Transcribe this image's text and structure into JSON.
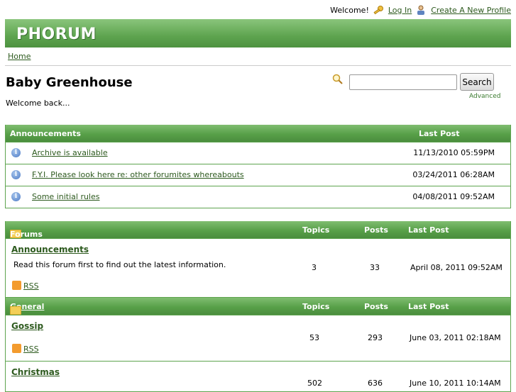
{
  "topbar": {
    "welcome": "Welcome!",
    "login": "Log In",
    "create_profile": "Create A New Profile"
  },
  "header": {
    "logo": "PHORUM"
  },
  "breadcrumb": {
    "home": "Home"
  },
  "page": {
    "title": "Baby Greenhouse",
    "description": "Welcome back..."
  },
  "search": {
    "value": "",
    "button": "Search",
    "advanced": "Advanced"
  },
  "announcements": {
    "header": "Announcements",
    "last_post_header": "Last Post",
    "items": [
      {
        "title": "Archive is available",
        "date": "11/13/2010 05:59PM"
      },
      {
        "title": "F.Y.I. Please look here re: other forumites whereabouts",
        "date": "03/24/2011 06:28AM"
      },
      {
        "title": "Some initial rules",
        "date": "04/08/2011 09:52AM"
      }
    ]
  },
  "forums": {
    "header": "Forums",
    "col_topics": "Topics",
    "col_posts": "Posts",
    "col_last_post": "Last Post",
    "items": [
      {
        "name": "Announcements",
        "description": "Read this forum first to find out the latest information.",
        "topics": "3",
        "posts": "33",
        "last_post": "April 08, 2011 09:52AM",
        "rss": "RSS"
      }
    ]
  },
  "general": {
    "header": "General",
    "col_topics": "Topics",
    "col_posts": "Posts",
    "col_last_post": "Last Post",
    "items": [
      {
        "name": "Gossip",
        "topics": "53",
        "posts": "293",
        "last_post": "June 03, 2011 02:18AM",
        "rss": "RSS"
      },
      {
        "name": "Christmas",
        "topics": "502",
        "posts": "636",
        "last_post": "June 10, 2011 10:14AM"
      }
    ]
  },
  "colors": {
    "accent": "#5ea44f",
    "link": "#2d5a1e"
  }
}
